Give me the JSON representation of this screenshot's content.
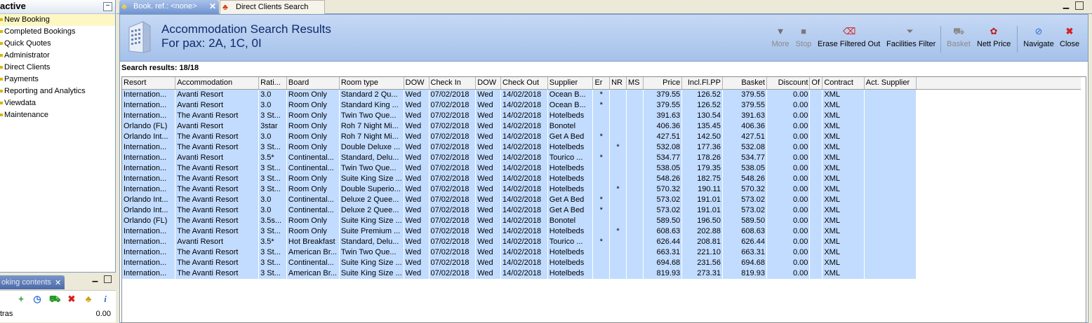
{
  "nav": {
    "title": "active",
    "items": [
      "New Booking",
      "Completed Bookings",
      "Quick Quotes",
      "Administrator",
      "Direct Clients",
      "Payments",
      "Reporting and Analytics",
      "Viewdata",
      "Maintenance"
    ]
  },
  "basket": {
    "tab_label": "oking contents",
    "row_label": "tras",
    "row_value": "0.00"
  },
  "tabs": [
    {
      "label": "Book. ref.: <none>",
      "icon": "palm-tree-icon"
    },
    {
      "label": "Direct Clients Search",
      "icon": "palm-tree-icon"
    }
  ],
  "header": {
    "title": "Accommodation Search Results",
    "subtitle": "For pax: 2A, 1C, 0I"
  },
  "toolbar": [
    {
      "label": "More",
      "icon": "triangle-down-icon",
      "enabled": false
    },
    {
      "label": "Stop",
      "icon": "stop-icon",
      "enabled": false
    },
    {
      "label": "Erase Filtered Out",
      "icon": "erase-icon",
      "enabled": true
    },
    {
      "label": "Facilities Filter",
      "icon": "filter-icon",
      "enabled": true
    },
    {
      "label": "Basket",
      "icon": "basket-icon",
      "enabled": false
    },
    {
      "label": "Nett Price",
      "icon": "nett-price-icon",
      "enabled": true
    },
    {
      "label": "Navigate",
      "icon": "navigate-icon",
      "enabled": true
    },
    {
      "label": "Close",
      "icon": "close-icon",
      "enabled": true
    }
  ],
  "results_label": "Search results: 18/18",
  "table": {
    "columns": [
      "Resort",
      "Accommodation",
      "Rati...",
      "Board",
      "Room type",
      "DOW",
      "Check In",
      "DOW",
      "Check Out",
      "Supplier",
      "Er",
      "NR",
      "MS",
      "Price",
      "Incl.Fl.PP",
      "Basket",
      "Discount",
      "Of",
      "Contract",
      "Act. Supplier"
    ],
    "rows": [
      [
        "Internation...",
        "Avanti Resort",
        "3.0",
        "Room Only",
        "Standard 2 Qu...",
        "Wed",
        "07/02/2018",
        "Wed",
        "14/02/2018",
        "Ocean B...",
        "*",
        "",
        "",
        "379.55",
        "126.52",
        "379.55",
        "0.00",
        "",
        "XML",
        ""
      ],
      [
        "Internation...",
        "Avanti Resort",
        "3.0",
        "Room Only",
        "Standard King ...",
        "Wed",
        "07/02/2018",
        "Wed",
        "14/02/2018",
        "Ocean B...",
        "*",
        "",
        "",
        "379.55",
        "126.52",
        "379.55",
        "0.00",
        "",
        "XML",
        ""
      ],
      [
        "Internation...",
        "The Avanti Resort",
        "3 St...",
        "Room Only",
        "Twin Two Que...",
        "Wed",
        "07/02/2018",
        "Wed",
        "14/02/2018",
        "Hotelbeds",
        "",
        "",
        "",
        "391.63",
        "130.54",
        "391.63",
        "0.00",
        "",
        "XML",
        ""
      ],
      [
        "Orlando (FL)",
        "Avanti Resort",
        "3star",
        "Room Only",
        "Roh 7 Night Mi...",
        "Wed",
        "07/02/2018",
        "Wed",
        "14/02/2018",
        "Bonotel",
        "",
        "",
        "",
        "406.36",
        "135.45",
        "406.36",
        "0.00",
        "",
        "XML",
        ""
      ],
      [
        "Orlando Int...",
        "The Avanti Resort",
        "3.0",
        "Room Only",
        "Roh 7 Night Mi...",
        "Wed",
        "07/02/2018",
        "Wed",
        "14/02/2018",
        "Get A Bed",
        "*",
        "",
        "",
        "427.51",
        "142.50",
        "427.51",
        "0.00",
        "",
        "XML",
        ""
      ],
      [
        "Internation...",
        "The Avanti Resort",
        "3 St...",
        "Room Only",
        "Double Deluxe ...",
        "Wed",
        "07/02/2018",
        "Wed",
        "14/02/2018",
        "Hotelbeds",
        "",
        "*",
        "",
        "532.08",
        "177.36",
        "532.08",
        "0.00",
        "",
        "XML",
        ""
      ],
      [
        "Internation...",
        "Avanti Resort",
        "3.5*",
        "Continental...",
        "Standard, Delu...",
        "Wed",
        "07/02/2018",
        "Wed",
        "14/02/2018",
        "Tourico ...",
        "*",
        "",
        "",
        "534.77",
        "178.26",
        "534.77",
        "0.00",
        "",
        "XML",
        ""
      ],
      [
        "Internation...",
        "The Avanti Resort",
        "3 St...",
        "Continental...",
        "Twin Two Que...",
        "Wed",
        "07/02/2018",
        "Wed",
        "14/02/2018",
        "Hotelbeds",
        "",
        "",
        "",
        "538.05",
        "179.35",
        "538.05",
        "0.00",
        "",
        "XML",
        ""
      ],
      [
        "Internation...",
        "The Avanti Resort",
        "3 St...",
        "Room Only",
        "Suite King Size ...",
        "Wed",
        "07/02/2018",
        "Wed",
        "14/02/2018",
        "Hotelbeds",
        "",
        "",
        "",
        "548.26",
        "182.75",
        "548.26",
        "0.00",
        "",
        "XML",
        ""
      ],
      [
        "Internation...",
        "The Avanti Resort",
        "3 St...",
        "Room Only",
        "Double Superio...",
        "Wed",
        "07/02/2018",
        "Wed",
        "14/02/2018",
        "Hotelbeds",
        "",
        "*",
        "",
        "570.32",
        "190.11",
        "570.32",
        "0.00",
        "",
        "XML",
        ""
      ],
      [
        "Orlando Int...",
        "The Avanti Resort",
        "3.0",
        "Continental...",
        "Deluxe 2 Quee...",
        "Wed",
        "07/02/2018",
        "Wed",
        "14/02/2018",
        "Get A Bed",
        "*",
        "",
        "",
        "573.02",
        "191.01",
        "573.02",
        "0.00",
        "",
        "XML",
        ""
      ],
      [
        "Orlando Int...",
        "The Avanti Resort",
        "3.0",
        "Continental...",
        "Deluxe 2 Quee...",
        "Wed",
        "07/02/2018",
        "Wed",
        "14/02/2018",
        "Get A Bed",
        "*",
        "",
        "",
        "573.02",
        "191.01",
        "573.02",
        "0.00",
        "",
        "XML",
        ""
      ],
      [
        "Orlando (FL)",
        "The Avanti Resort",
        "3.5s...",
        "Room Only",
        "Suite King Size ...",
        "Wed",
        "07/02/2018",
        "Wed",
        "14/02/2018",
        "Bonotel",
        "",
        "",
        "",
        "589.50",
        "196.50",
        "589.50",
        "0.00",
        "",
        "XML",
        ""
      ],
      [
        "Internation...",
        "The Avanti Resort",
        "3 St...",
        "Room Only",
        "Suite Premium ...",
        "Wed",
        "07/02/2018",
        "Wed",
        "14/02/2018",
        "Hotelbeds",
        "",
        "*",
        "",
        "608.63",
        "202.88",
        "608.63",
        "0.00",
        "",
        "XML",
        ""
      ],
      [
        "Internation...",
        "Avanti Resort",
        "3.5*",
        "Hot Breakfast",
        "Standard, Delu...",
        "Wed",
        "07/02/2018",
        "Wed",
        "14/02/2018",
        "Tourico ...",
        "*",
        "",
        "",
        "626.44",
        "208.81",
        "626.44",
        "0.00",
        "",
        "XML",
        ""
      ],
      [
        "Internation...",
        "The Avanti Resort",
        "3 St...",
        "American Br...",
        "Twin Two Que...",
        "Wed",
        "07/02/2018",
        "Wed",
        "14/02/2018",
        "Hotelbeds",
        "",
        "",
        "",
        "663.31",
        "221.10",
        "663.31",
        "0.00",
        "",
        "XML",
        ""
      ],
      [
        "Internation...",
        "The Avanti Resort",
        "3 St...",
        "Continental...",
        "Suite King Size ...",
        "Wed",
        "07/02/2018",
        "Wed",
        "14/02/2018",
        "Hotelbeds",
        "",
        "",
        "",
        "694.68",
        "231.56",
        "694.68",
        "0.00",
        "",
        "XML",
        ""
      ],
      [
        "Internation...",
        "The Avanti Resort",
        "3 St...",
        "American Br...",
        "Suite King Size ...",
        "Wed",
        "07/02/2018",
        "Wed",
        "14/02/2018",
        "Hotelbeds",
        "",
        "",
        "",
        "819.93",
        "273.31",
        "819.93",
        "0.00",
        "",
        "XML",
        ""
      ]
    ]
  },
  "colors": {
    "row_bg": "#c2dcff",
    "header_bg": "#a5c1ea",
    "title": "#0d2b6b",
    "close_red": "#d62020"
  }
}
